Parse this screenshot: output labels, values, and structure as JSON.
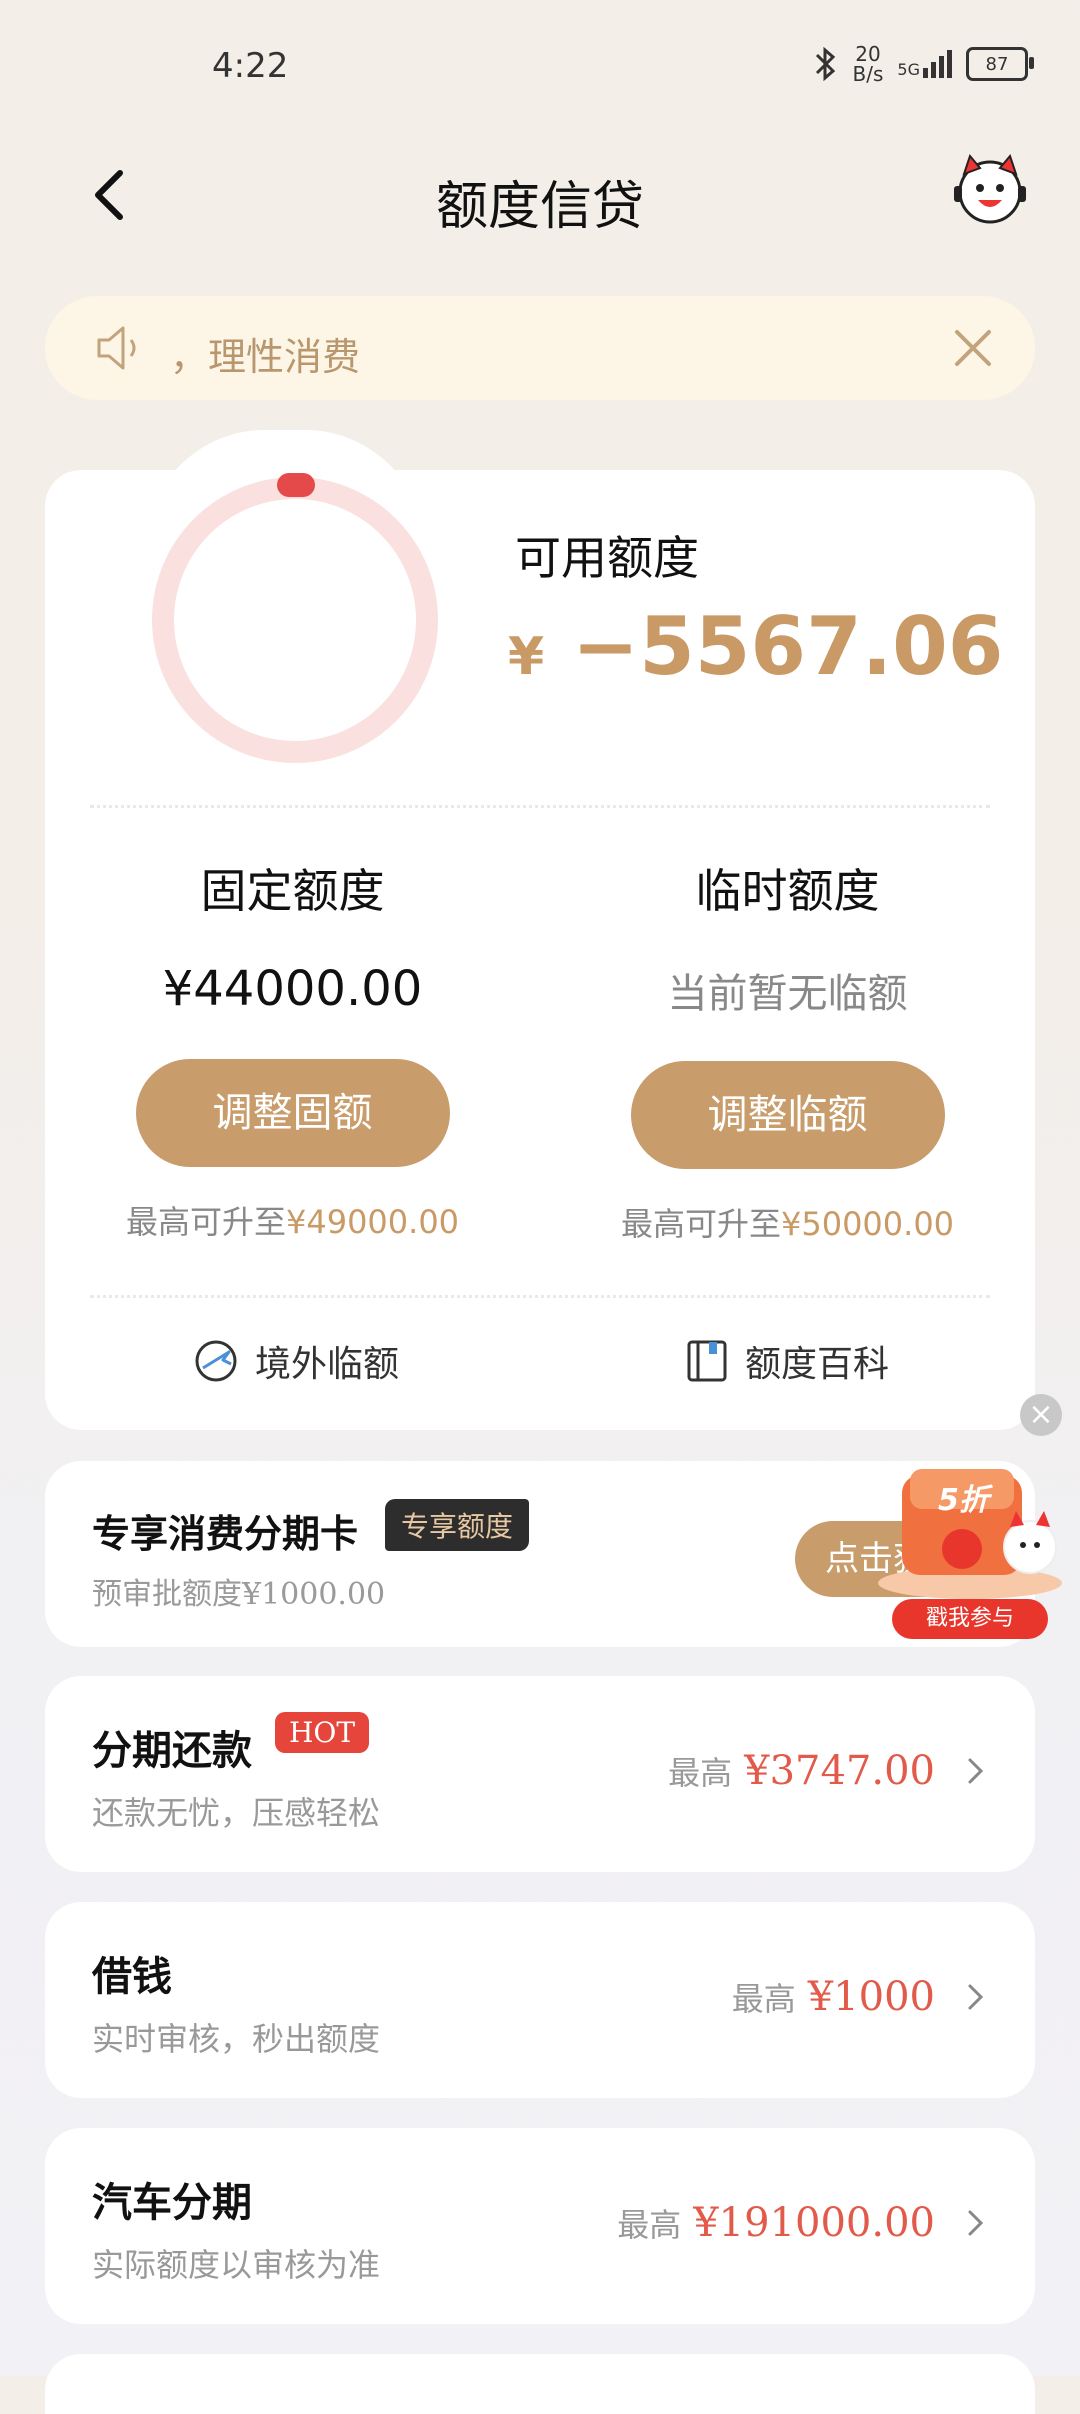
{
  "status": {
    "time": "4:22",
    "net_speed_top": "20",
    "net_speed_bottom": "B/s",
    "signal": "5G",
    "battery": "87"
  },
  "header": {
    "title": "额度信贷"
  },
  "notice": {
    "text": "，理性消费"
  },
  "credit": {
    "available_label": "可用额度",
    "available_currency": "¥",
    "available_amount": "−5567.06",
    "fixed": {
      "title": "固定额度",
      "value": "¥44000.00",
      "button": "调整固额",
      "hint_prefix": "最高可升至",
      "hint_amount": "¥49000.00"
    },
    "temp": {
      "title": "临时额度",
      "value": "当前暂无临额",
      "button": "调整临额",
      "hint_prefix": "最高可升至",
      "hint_amount": "¥50000.00"
    },
    "links": [
      {
        "label": "境外临额"
      },
      {
        "label": "额度百科"
      }
    ]
  },
  "promo": {
    "title": "专享消费分期卡",
    "badge": "专享额度",
    "subtitle": "预审批额度¥1000.00",
    "button": "点击获",
    "gift_discount": "5折",
    "gift_label": "戳我参与"
  },
  "rows": [
    {
      "title": "分期还款",
      "tag": "HOT",
      "subtitle": "还款无忧，压感轻松",
      "prefix": "最高",
      "amount": "¥3747.00"
    },
    {
      "title": "借钱",
      "subtitle": "实时审核，秒出额度",
      "prefix": "最高",
      "amount": "¥1000"
    },
    {
      "title": "汽车分期",
      "subtitle": "实际额度以审核为准",
      "prefix": "最高",
      "amount": "¥191000.00"
    }
  ],
  "colors": {
    "gold": "#c89c6b",
    "red": "#e25a4a",
    "notice_bg": "#fdf6e6"
  }
}
